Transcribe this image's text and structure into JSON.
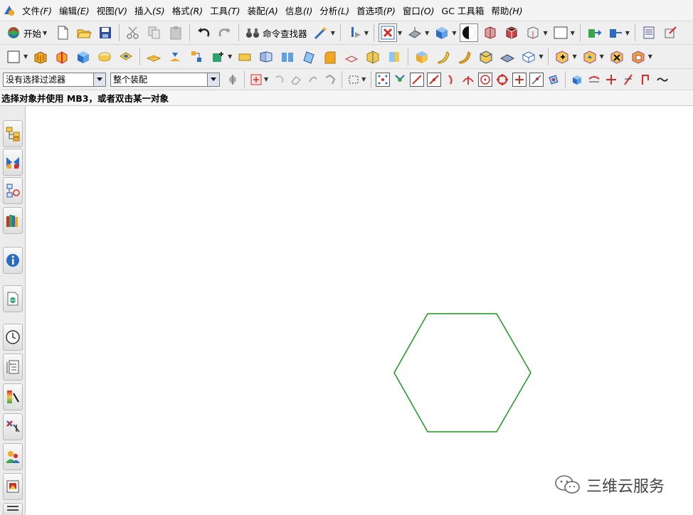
{
  "menubar": {
    "items": [
      {
        "label": "文件",
        "accel": "(F)"
      },
      {
        "label": "编辑",
        "accel": "(E)"
      },
      {
        "label": "视图",
        "accel": "(V)"
      },
      {
        "label": "插入",
        "accel": "(S)"
      },
      {
        "label": "格式",
        "accel": "(R)"
      },
      {
        "label": "工具",
        "accel": "(T)"
      },
      {
        "label": "装配",
        "accel": "(A)"
      },
      {
        "label": "信息",
        "accel": "(I)"
      },
      {
        "label": "分析",
        "accel": "(L)"
      },
      {
        "label": "首选项",
        "accel": "(P)"
      },
      {
        "label": "窗口",
        "accel": "(O)"
      },
      {
        "label": "GC 工具箱",
        "accel": ""
      },
      {
        "label": "帮助",
        "accel": "(H)"
      }
    ]
  },
  "toolbar": {
    "start_label": "开始",
    "command_finder_label": "命令查找器"
  },
  "selection_bar": {
    "filter_value": "没有选择过滤器",
    "scope_value": "整个装配"
  },
  "status": {
    "message": "选择对象并使用 MB3，或者双击某一对象"
  },
  "canvas": {
    "shape": "hexagon",
    "stroke_color": "#1a9a1a",
    "background": "#ffffff"
  },
  "watermark": {
    "text": "三维云服务"
  },
  "colors": {
    "accent_blue": "#2b6cc4",
    "accent_orange": "#f2a623",
    "accent_red": "#d62b2b"
  }
}
